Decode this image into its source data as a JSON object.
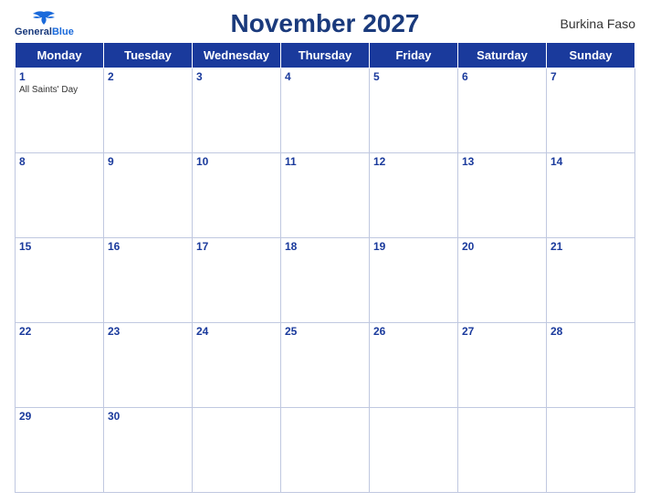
{
  "header": {
    "logo_general": "General",
    "logo_blue": "Blue",
    "title": "November 2027",
    "country": "Burkina Faso"
  },
  "weekdays": [
    "Monday",
    "Tuesday",
    "Wednesday",
    "Thursday",
    "Friday",
    "Saturday",
    "Sunday"
  ],
  "weeks": [
    [
      {
        "day": "1",
        "event": "All Saints' Day"
      },
      {
        "day": "2",
        "event": ""
      },
      {
        "day": "3",
        "event": ""
      },
      {
        "day": "4",
        "event": ""
      },
      {
        "day": "5",
        "event": ""
      },
      {
        "day": "6",
        "event": ""
      },
      {
        "day": "7",
        "event": ""
      }
    ],
    [
      {
        "day": "8",
        "event": ""
      },
      {
        "day": "9",
        "event": ""
      },
      {
        "day": "10",
        "event": ""
      },
      {
        "day": "11",
        "event": ""
      },
      {
        "day": "12",
        "event": ""
      },
      {
        "day": "13",
        "event": ""
      },
      {
        "day": "14",
        "event": ""
      }
    ],
    [
      {
        "day": "15",
        "event": ""
      },
      {
        "day": "16",
        "event": ""
      },
      {
        "day": "17",
        "event": ""
      },
      {
        "day": "18",
        "event": ""
      },
      {
        "day": "19",
        "event": ""
      },
      {
        "day": "20",
        "event": ""
      },
      {
        "day": "21",
        "event": ""
      }
    ],
    [
      {
        "day": "22",
        "event": ""
      },
      {
        "day": "23",
        "event": ""
      },
      {
        "day": "24",
        "event": ""
      },
      {
        "day": "25",
        "event": ""
      },
      {
        "day": "26",
        "event": ""
      },
      {
        "day": "27",
        "event": ""
      },
      {
        "day": "28",
        "event": ""
      }
    ],
    [
      {
        "day": "29",
        "event": ""
      },
      {
        "day": "30",
        "event": ""
      },
      {
        "day": "",
        "event": ""
      },
      {
        "day": "",
        "event": ""
      },
      {
        "day": "",
        "event": ""
      },
      {
        "day": "",
        "event": ""
      },
      {
        "day": "",
        "event": ""
      }
    ]
  ],
  "colors": {
    "header_bg": "#1a3a9c",
    "header_text": "#ffffff",
    "title_color": "#1a3a7c",
    "day_num_color": "#1a3a9c"
  }
}
